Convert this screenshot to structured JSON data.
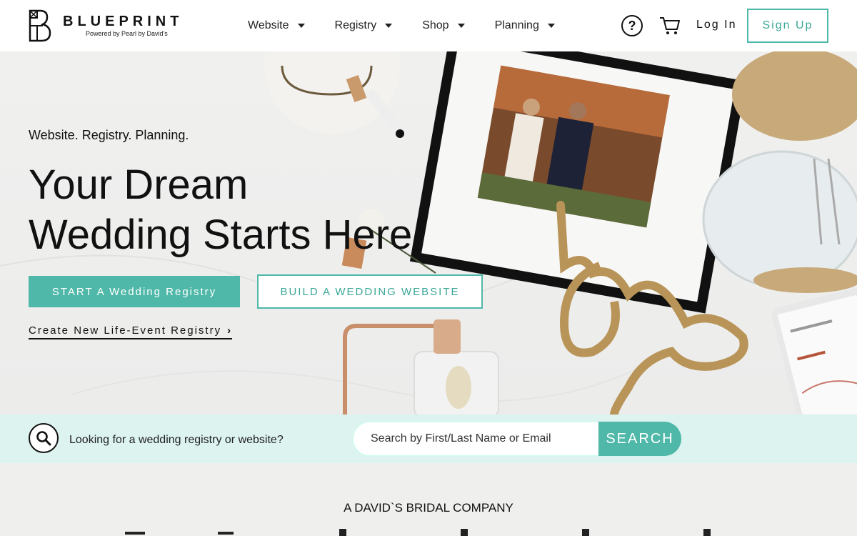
{
  "brand": {
    "name": "BLUEPRINT",
    "subtitle": "Powered by Pearl by David's"
  },
  "nav": {
    "items": [
      {
        "label": "Website"
      },
      {
        "label": "Registry"
      },
      {
        "label": "Shop"
      },
      {
        "label": "Planning"
      }
    ],
    "help_icon": "question-circle-icon",
    "cart_icon": "cart-icon",
    "login_label": "Log In",
    "signup_label": "Sign Up"
  },
  "hero": {
    "tagline": "Website. Registry. Planning.",
    "headline_line1": "Your Dream",
    "headline_line2": "Wedding Starts Here.",
    "start_button": "START A Wedding Registry",
    "build_button": "BUILD A WEDDING WEBSITE",
    "life_event_link": "Create New Life-Event Registry"
  },
  "search": {
    "prompt": "Looking for a wedding registry or website?",
    "placeholder": "Search by First/Last Name or Email",
    "button_label": "SEARCH"
  },
  "footer": {
    "company": "A DAVID`S BRIDAL COMPANY"
  },
  "colors": {
    "accent": "#4fb8a8",
    "search_band": "#dcf3ef"
  }
}
